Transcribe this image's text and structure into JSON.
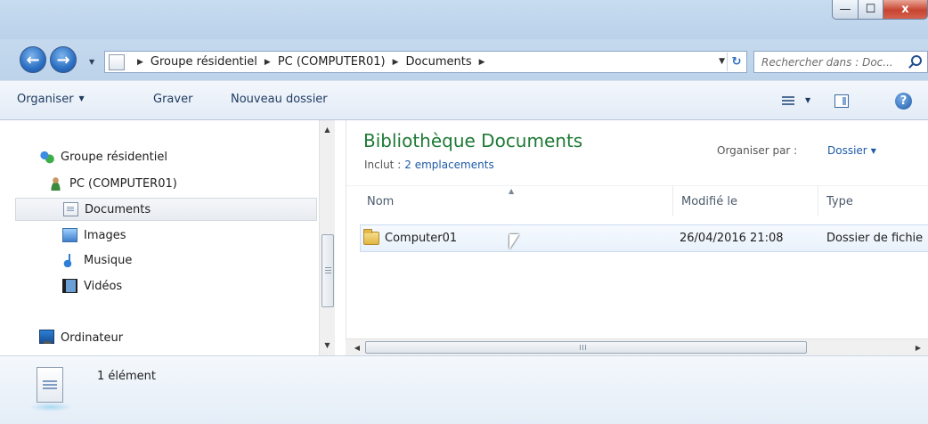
{
  "window": {
    "minimize_glyph": "—",
    "maximize_glyph": "☐",
    "close_glyph": "x"
  },
  "nav": {
    "back_glyph": "←",
    "forward_glyph": "→",
    "dropdown_glyph": "▼",
    "breadcrumbs": [
      "Groupe résidentiel",
      "PC (COMPUTER01)",
      "Documents"
    ],
    "breadcrumb_separator": "▶",
    "address_dropdown_glyph": "▼",
    "refresh_glyph": "↻",
    "search_placeholder": "Rechercher dans : Doc..."
  },
  "toolbar": {
    "organize_label": "Organiser",
    "organize_caret": "▼",
    "burn_label": "Graver",
    "new_folder_label": "Nouveau dossier",
    "view_caret": "▼",
    "help_glyph": "?"
  },
  "sidebar": {
    "items": [
      {
        "label": "Groupe résidentiel",
        "icon": "homegroup-icon"
      },
      {
        "label": "PC (COMPUTER01)",
        "icon": "user-icon"
      },
      {
        "label": "Documents",
        "icon": "documents-icon",
        "selected": true
      },
      {
        "label": "Images",
        "icon": "images-icon"
      },
      {
        "label": "Musique",
        "icon": "music-icon"
      },
      {
        "label": "Vidéos",
        "icon": "videos-icon"
      },
      {
        "label": "Ordinateur",
        "icon": "computer-icon"
      }
    ],
    "scroll_up_glyph": "▲",
    "scroll_down_glyph": "▼"
  },
  "library": {
    "title": "Bibliothèque Documents",
    "includes_label": "Inclut :",
    "includes_link": "2 emplacements",
    "arrange_label": "Organiser par :",
    "arrange_value": "Dossier",
    "arrange_caret": "▼"
  },
  "table": {
    "sort_glyph": "▲",
    "columns": [
      "Nom",
      "Modifié le",
      "Type"
    ],
    "rows": [
      {
        "name": "Computer01",
        "modified": "26/04/2016 21:08",
        "type": "Dossier de fichie"
      }
    ],
    "hscroll_left_glyph": "◀",
    "hscroll_right_glyph": "▶"
  },
  "details": {
    "count_text": "1 élément"
  },
  "colors": {
    "library_title": "#1e7a35",
    "link": "#1c5aa6",
    "selection_border": "#c9dcf2"
  }
}
